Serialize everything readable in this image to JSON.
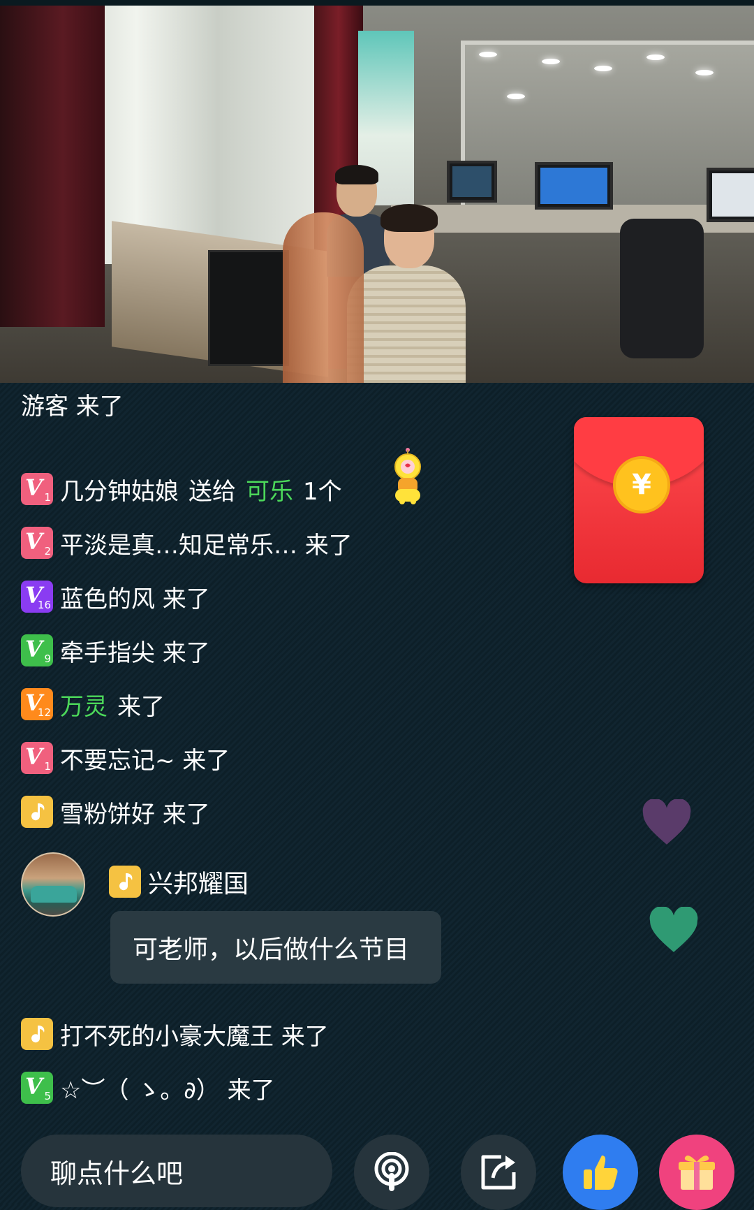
{
  "chat": {
    "guest_line": "游客 来了",
    "messages": [
      {
        "level": "1",
        "user": "几分钟姑娘",
        "action": "送给",
        "target": "可乐",
        "count": "1个"
      },
      {
        "level": "2",
        "text": "平淡是真…知足常乐… 来了"
      },
      {
        "level": "16",
        "text": "蓝色的风 来了"
      },
      {
        "level": "9",
        "text": "牵手指尖 来了"
      },
      {
        "level": "12",
        "user": "万灵",
        "text": "来了"
      },
      {
        "level": "1",
        "text": "不要忘记~ 来了"
      },
      {
        "text": "雪粉饼好 来了"
      },
      {
        "text": "打不死的小豪大魔王 来了"
      },
      {
        "level": "5",
        "text": "☆︶（ ゝ。∂） 来了"
      }
    ],
    "comment": {
      "sender": "兴邦耀国",
      "text": "可老师，以后做什么节目"
    }
  },
  "red_packet": {
    "symbol": "¥"
  },
  "bottom_bar": {
    "input_placeholder": "聊点什么吧"
  },
  "colors": {
    "accent_green": "#4cd85a",
    "like_blue": "#2f7df0",
    "gift_pink": "#f0427e",
    "red_packet": "#e82a31"
  }
}
